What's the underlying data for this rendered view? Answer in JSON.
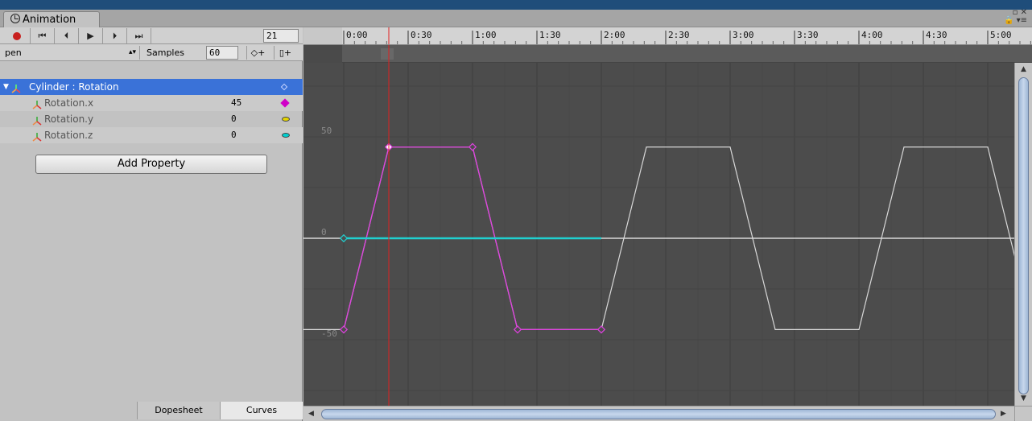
{
  "window": {
    "tab_title": "Animation",
    "controls": "▫ ✕",
    "lock": "🔒 ▾≡"
  },
  "toolbar": {
    "buttons": [
      "record",
      "first-key",
      "prev-key",
      "play",
      "next-key",
      "last-key"
    ],
    "glyphs": [
      "⏮",
      "⏴",
      "▶",
      "⏵",
      "⏭"
    ],
    "frame": "21",
    "clip": "pen",
    "samples_label": "Samples",
    "samples": "60",
    "add_key": "◇+",
    "add_event": "▯+"
  },
  "hierarchy": {
    "group": "Cylinder : Rotation",
    "properties": [
      {
        "name": "Rotation.x",
        "value": "45",
        "color": "#d000c8"
      },
      {
        "name": "Rotation.y",
        "value": "0",
        "color": "#e5d500"
      },
      {
        "name": "Rotation.z",
        "value": "0",
        "color": "#00d0d0"
      }
    ],
    "add_property_label": "Add Property"
  },
  "bottom_tabs": {
    "dopesheet": "Dopesheet",
    "curves": "Curves"
  },
  "timeline": {
    "ticks": [
      "0:00",
      "0:30",
      "1:00",
      "1:30",
      "2:00",
      "2:30",
      "3:00",
      "3:30",
      "4:00",
      "4:30",
      "5:00"
    ],
    "current_frame": 21,
    "y_labels": [
      "50",
      "0",
      "-50"
    ],
    "colors": {
      "rotation_x": "#e040e0",
      "rotation_z": "#20d0d0",
      "loop": "#d8d8d8",
      "playhead": "#e02020"
    },
    "curve_x_keys": [
      [
        0,
        -45
      ],
      [
        21,
        45
      ],
      [
        60,
        45
      ],
      [
        81,
        -45
      ],
      [
        120,
        -45
      ]
    ]
  }
}
